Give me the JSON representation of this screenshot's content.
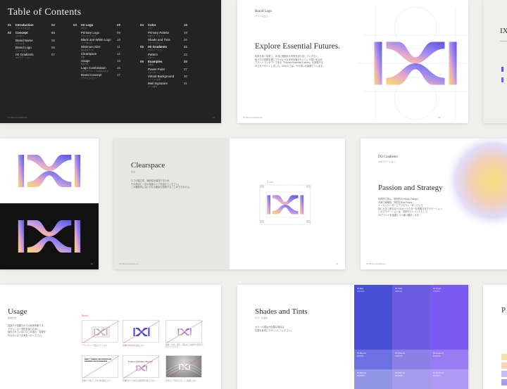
{
  "toc": {
    "title": "Table of Contents",
    "col1": [
      {
        "num": "01",
        "label": "Introduction",
        "sub": "ブランドの考え方",
        "page": "03"
      },
      {
        "num": "02",
        "label": "Concept",
        "sub": "コンセプト",
        "page": "04"
      },
      {
        "num": "",
        "label": "Brand Name",
        "sub": "ブランド名",
        "page": "05"
      },
      {
        "num": "",
        "label": "Brand Logo",
        "sub": "ブランドロゴ",
        "page": "06"
      },
      {
        "num": "",
        "label": "IXI Gradients",
        "sub": "IXIグラデーション",
        "page": "07"
      }
    ],
    "col2": [
      {
        "num": "03",
        "label": "IXI Logo",
        "sub": "IXIロゴ",
        "page": "08"
      },
      {
        "num": "",
        "label": "Primary Logo",
        "sub": "プライマリーロゴ",
        "page": "09"
      },
      {
        "num": "",
        "label": "Black and White Logo",
        "sub": "モノクロロゴ",
        "page": "10"
      },
      {
        "num": "",
        "label": "Minimum Size",
        "sub": "最小表示サイズ",
        "page": "11"
      },
      {
        "num": "",
        "label": "Clearspace",
        "sub": "余白",
        "page": "12"
      },
      {
        "num": "",
        "label": "Usage",
        "sub": "使用方法",
        "page": "13"
      },
      {
        "num": "",
        "label": "Logo Combination",
        "sub": "ロゴとグラフィックの組み合わせ",
        "page": "15"
      },
      {
        "num": "",
        "label": "Brand Concept",
        "sub": "ブランドコンセプト",
        "page": "17"
      }
    ],
    "col3": [
      {
        "num": "04",
        "label": "Color",
        "sub": "カラー",
        "page": "18"
      },
      {
        "num": "",
        "label": "Primary Palette",
        "sub": "主要カラーパレット",
        "page": "19"
      },
      {
        "num": "",
        "label": "Shade and Tints",
        "sub": "シェードとティント",
        "page": "20"
      },
      {
        "num": "05",
        "label": "IXI Gradients",
        "sub": "IXIグラデーション",
        "page": "21"
      },
      {
        "num": "",
        "label": "Pattern",
        "sub": "パターン",
        "page": "22"
      },
      {
        "num": "06",
        "label": "Examples",
        "sub": "使用例",
        "page": "26"
      },
      {
        "num": "",
        "label": "Power Point",
        "sub": "パワーポイント",
        "page": "27"
      },
      {
        "num": "",
        "label": "Virtual Background",
        "sub": "バーチャル背景",
        "page": "30"
      },
      {
        "num": "",
        "label": "Mail Signature",
        "sub": "メール署名",
        "page": "31"
      }
    ],
    "footer_left": "IXI Brand Guidelines",
    "footer_right": "02"
  },
  "brandlogo": {
    "section": "Brand Logo",
    "section_sub": "ブランドロゴ",
    "heading": "Explore Essential Futures.",
    "body": [
      "未来を深く探求し、本当に価値ある未来を創り出していきたい。",
      "私たちの事業を通じてそのような未来を届けたいという想いを込め、",
      "ブランドコンセプトである「Explore Essential Futures」を体現する",
      "ロゴをデザインしました。IXIのロゴは、その想いを象徴しています。"
    ],
    "footer_left": "IXI Brand Guidelines",
    "footer_right": "06"
  },
  "clearspace": {
    "heading": "Clearspace",
    "sub": "余白",
    "body": [
      "ロゴの独立性、識別性を保持するため、",
      "その周辺に一定の保護エリアを設けてください。",
      "この範囲内にはいかなる要素も配置することができません。"
    ],
    "footer_left": "IXI Brand Guidelines",
    "footer_right": "12",
    "marker": "1/2X"
  },
  "gradients": {
    "section": "IXI Gradients",
    "section_sub": "IXIグラデーション",
    "heading": "Passion and Strategy",
    "body": [
      "情熱的で熱心、現代的なYellow-Orangeと",
      "冷静で戦略的、知的なBlue-Purple。",
      "インキュベーターにアクセラレーターという",
      "特に大きく異なる2つのキャラクターを表現するグラデーション。",
      "このグラデーションは、背景やエレメントとして、",
      "IXIブランドを強調しつつ使い勝手します。"
    ],
    "footer_left": "IXI Brand Guidelines",
    "footer_right": "21"
  },
  "usage": {
    "heading": "Usage",
    "sub": "使用方法",
    "body": [
      "見誤りや誤解なのでの利用判断です。",
      "デザイン上一貫性を保つために、",
      "操作されていないロゴの表示・変更を",
      "行わないようお気をつけください。"
    ],
    "dont_label": "Don'ts",
    "captions": [
      "アウトラインで囲んだりしない",
      "画像化や比率を変更しない",
      "破損、分割、変形、回転などの操作や変形をしないでください",
      "文章の一部としてロゴを使用しない",
      "画像内の上で文字の視認性を落とさない",
      "背景の上で色の見えにくい使用しない"
    ],
    "sample_text": "Explore Essential Futures"
  },
  "shades": {
    "heading": "Shades and Tints",
    "sub": "カラーの濃淡",
    "body": [
      "カラーの濃淡が必要な場合は",
      "右図を参考にデザインしてください。"
    ],
    "swatches": [
      {
        "name": "IXI Blue",
        "codes": "#4A4FD8"
      },
      {
        "name": "IXI Violet",
        "codes": "#6A5CE0"
      },
      {
        "name": "IXI Purple",
        "codes": "#7A5AF0"
      }
    ],
    "tints": [
      {
        "name": "IXI Blue 60",
        "codes": "#9396E6"
      },
      {
        "name": "IXI Violet 60",
        "codes": "#A69CEB"
      },
      {
        "name": "IXI Purple 60",
        "codes": "#AD9AF4"
      },
      {
        "name": "IXI Blue 20",
        "codes": "#C9CBF4"
      },
      {
        "name": "IXI Violet 20",
        "codes": "#D2CDF6"
      },
      {
        "name": "IXI Purple 20",
        "codes": "#D7CDFA"
      }
    ]
  },
  "colors": {
    "blue": "#4a4fd8",
    "violet": "#6a5ce0",
    "purple": "#7a5af0",
    "yellow": "#f5d86a",
    "orange": "#f2b065",
    "dark": "#232323"
  }
}
